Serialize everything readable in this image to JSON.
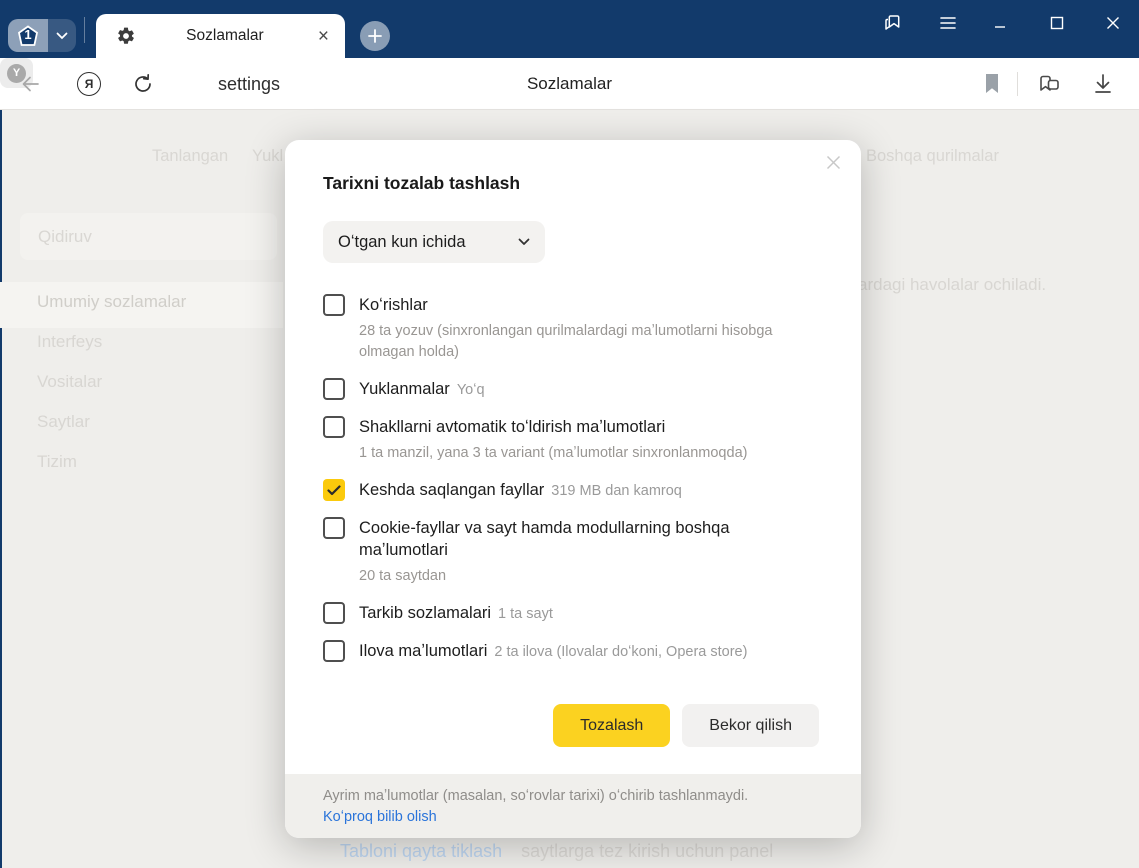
{
  "window": {
    "tab_count": "1",
    "tab_title": "Sozlamalar",
    "new_tab": "+",
    "colors": {
      "titlebar": "#123a6b",
      "accent_yellow": "#fbd220",
      "link_blue": "#2a74da"
    }
  },
  "toolbar": {
    "url": "settings",
    "page_title": "Sozlamalar"
  },
  "background": {
    "tabs": [
      {
        "label": "Tanlangan"
      },
      {
        "label": "Yukl"
      },
      {
        "label": "Boshqa qurilmalar"
      }
    ],
    "search_placeholder": "Qidiruv",
    "sidebar": [
      {
        "label": "Umumiy sozlamalar"
      },
      {
        "label": "Interfeys"
      },
      {
        "label": "Vositalar"
      },
      {
        "label": "Saytlar"
      },
      {
        "label": "Tizim"
      }
    ],
    "fragment_text": "ardagi havolalar ochiladi.",
    "bottom_link": "Tabloni qayta tiklash",
    "bottom_text": "saytlarga tez kirish uchun panel"
  },
  "dialog": {
    "title": "Tarixni tozalab tashlash",
    "range_selected": "Oʻtgan kun ichida",
    "items": [
      {
        "label": "Koʻrishlar",
        "checked": false,
        "sub": "28 ta yozuv (sinxronlangan qurilmalardagi maʼlumotlarni hisobga olmagan holda)"
      },
      {
        "label": "Yuklanmalar",
        "checked": false,
        "inline": "Yoʻq"
      },
      {
        "label": "Shakllarni avtomatik toʻldirish maʼlumotlari",
        "checked": false,
        "sub": "1 ta manzil, yana 3 ta variant (maʼlumotlar sinxronlanmoqda)"
      },
      {
        "label": "Keshda saqlangan fayllar",
        "checked": true,
        "inline": "319 MB dan kamroq"
      },
      {
        "label": "Cookie-fayllar va sayt hamda modullarning boshqa maʼlumotlari",
        "checked": false,
        "sub": "20 ta saytdan"
      },
      {
        "label": "Tarkib sozlamalari",
        "checked": false,
        "inline": "1 ta sayt"
      },
      {
        "label": "Ilova maʼlumotlari",
        "checked": false,
        "inline": "2 ta ilova (Ilovalar doʻkoni, Opera store)"
      }
    ],
    "clear_button": "Tozalash",
    "cancel_button": "Bekor qilish",
    "footer_note": "Ayrim maʼlumotlar (masalan, soʻrovlar tarixi) oʻchirib tashlanmaydi.",
    "footer_link": "Koʻproq bilib olish"
  }
}
